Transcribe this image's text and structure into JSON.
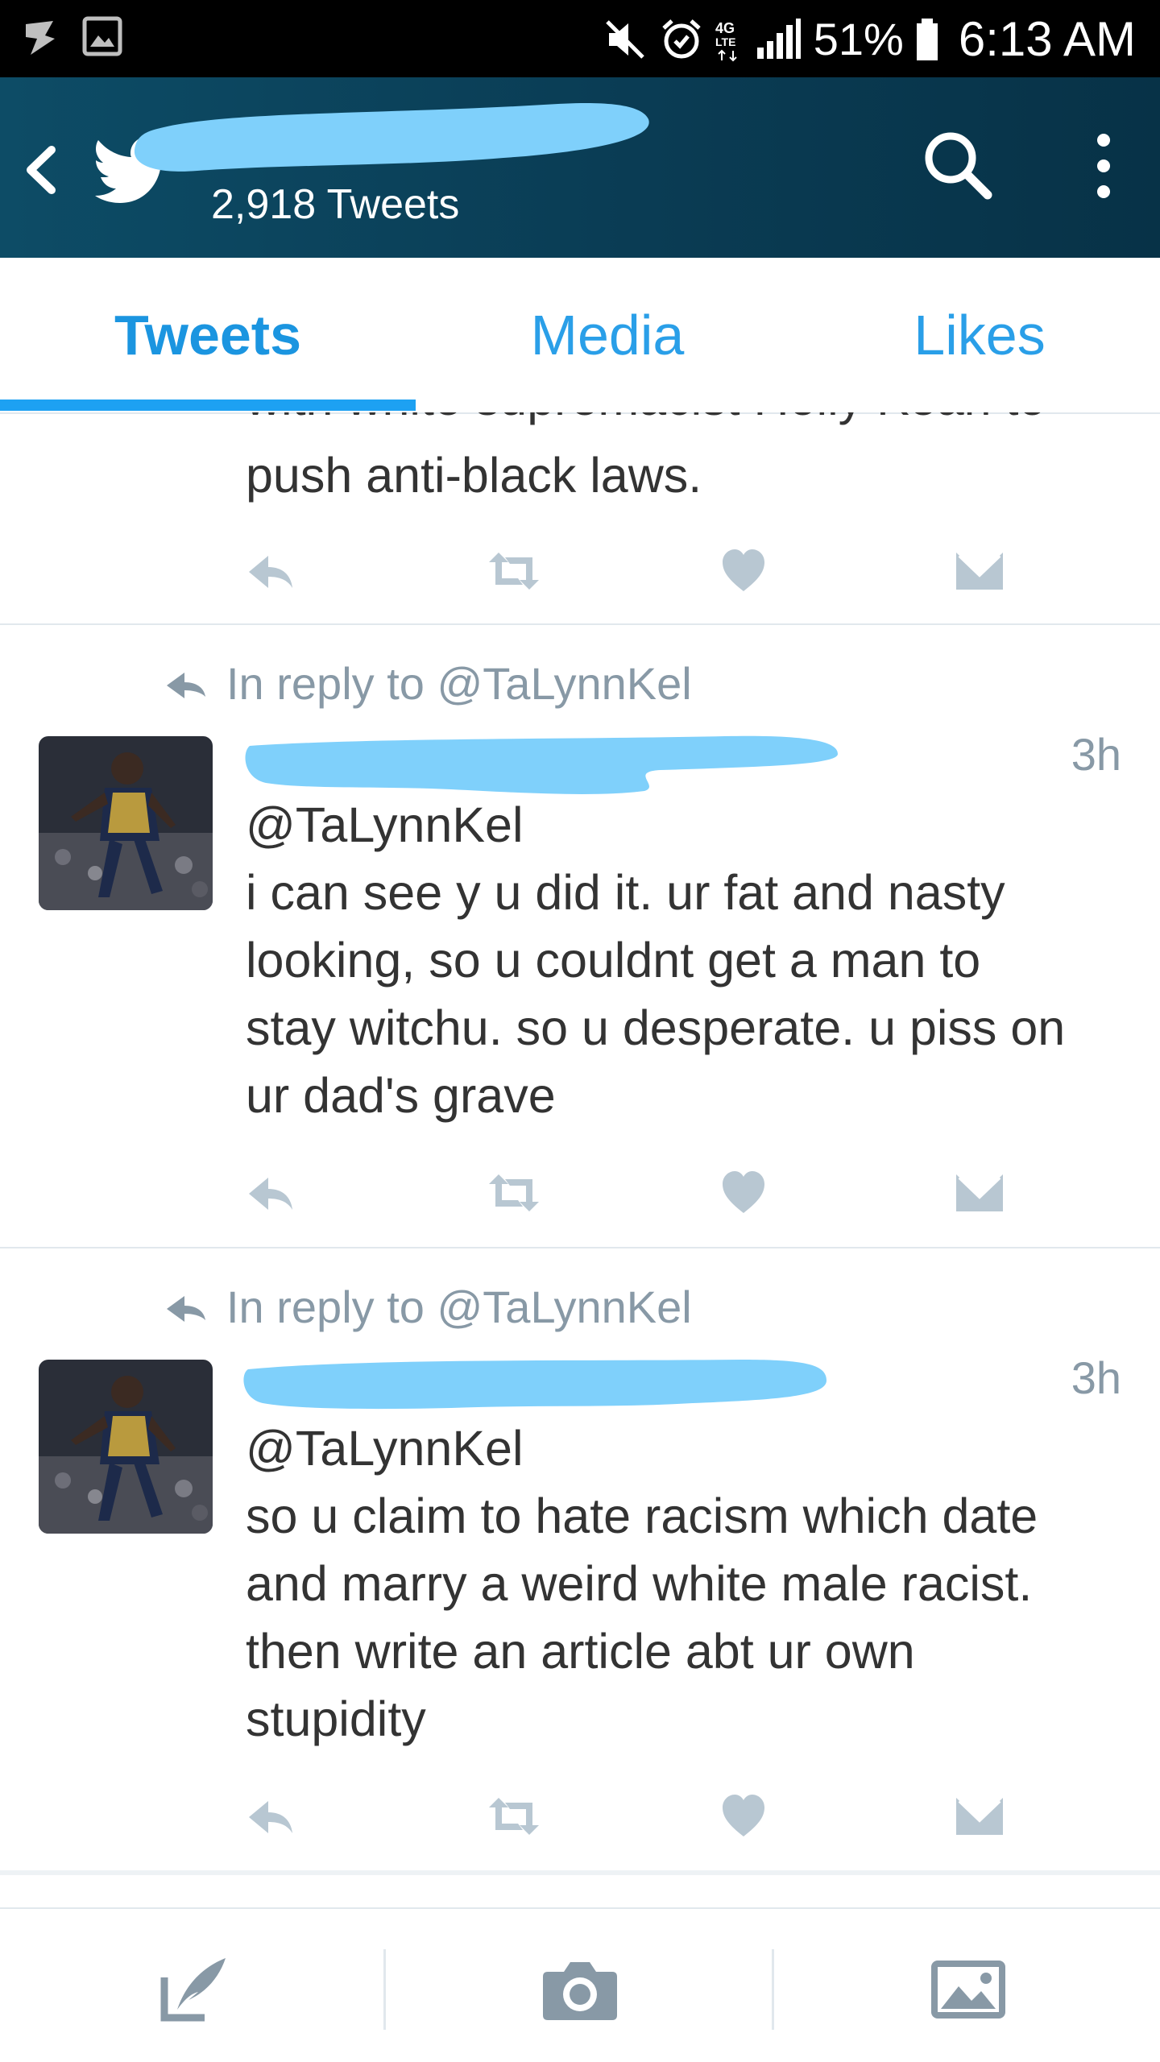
{
  "status_bar": {
    "battery": "51%",
    "time": "6:13 AM",
    "network": "4G LTE",
    "icons_left": [
      "notification-icon",
      "gallery-icon"
    ],
    "icons_right": [
      "mute-icon",
      "alarm-icon",
      "network-icon",
      "signal-icon",
      "battery-icon"
    ]
  },
  "header": {
    "tweet_count": "2,918 Tweets"
  },
  "tabs": [
    {
      "label": "Tweets",
      "active": true
    },
    {
      "label": "Media",
      "active": false
    },
    {
      "label": "Likes",
      "active": false
    }
  ],
  "feed": {
    "partial_tweet": {
      "line1": "with white supremacist Holly Kean to",
      "line2": "push anti-black laws."
    },
    "tweets": [
      {
        "reply_to": "In reply to @TaLynnKel",
        "time": "3h",
        "mention": "@TaLynnKel",
        "lines": [
          "i can see y u did it. ur fat and nasty",
          "looking, so u couldnt get a man to",
          "stay witchu. so u desperate. u piss on",
          "ur dad's grave"
        ]
      },
      {
        "reply_to": "In reply to @TaLynnKel",
        "time": "3h",
        "mention": "@TaLynnKel",
        "lines": [
          "so u claim to hate racism which date",
          "and marry a weird white male racist.",
          "then write an article abt ur own",
          "stupidity"
        ]
      }
    ]
  },
  "colors": {
    "accent": "#1da1f2",
    "header_bg": "#0a3c54",
    "redaction": "#7fd0fb",
    "action_icon": "#b8c7d2"
  },
  "bottom_bar": [
    "compose-tweet-icon",
    "camera-icon",
    "photo-gallery-icon"
  ]
}
